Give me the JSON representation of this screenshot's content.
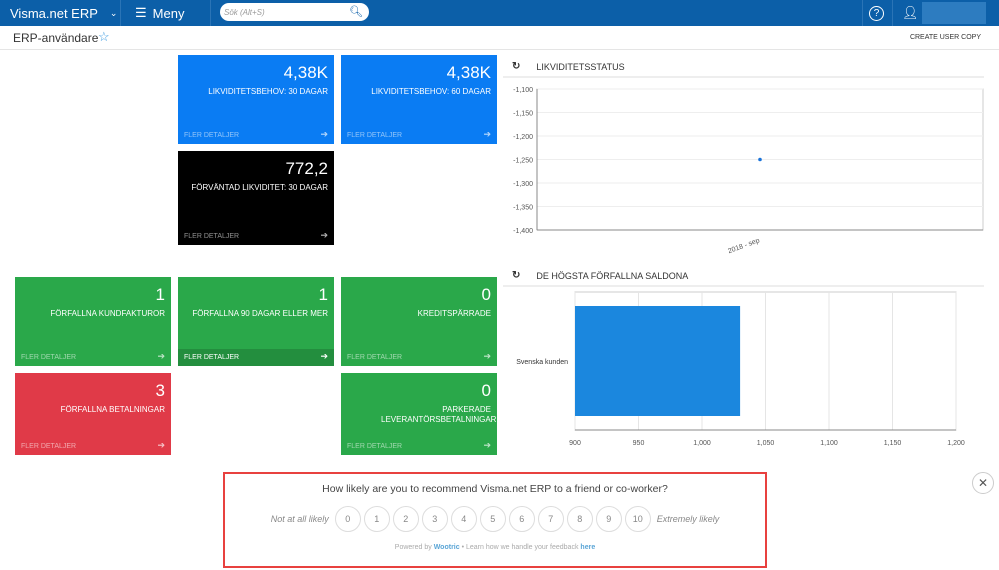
{
  "topbar": {
    "app": "Visma.net ERP",
    "menu": "Meny",
    "search_placeholder": "Sök (Alt+S)"
  },
  "page": {
    "title": "ERP-användare",
    "action": "CREATE USER COPY"
  },
  "tiles": [
    {
      "value": "4,38K",
      "label": "LIKVIDITETSBEHOV: 30 DAGAR",
      "more": "FLER DETALJER"
    },
    {
      "value": "4,38K",
      "label": "LIKVIDITETSBEHOV: 60 DAGAR",
      "more": "FLER DETALJER"
    },
    {
      "value": "772,2",
      "label": "FÖRVÄNTAD LIKVIDITET: 30 DAGAR",
      "more": "FLER DETALJER"
    },
    {
      "value": "1",
      "label": "FÖRFALLNA KUNDFAKTUROR",
      "more": "FLER DETALJER"
    },
    {
      "value": "1",
      "label": "FÖRFALLNA 90 DAGAR ELLER MER",
      "more": "FLER DETALJER"
    },
    {
      "value": "0",
      "label": "KREDITSPÄRRADE",
      "more": "FLER DETALJER"
    },
    {
      "value": "3",
      "label": "FÖRFALLNA BETALNINGAR",
      "more": "FLER DETALJER"
    },
    {
      "value": "0",
      "label": "PARKERADE LEVERANTÖRSBETALNINGAR",
      "more": "FLER DETALJER"
    }
  ],
  "chart_data": [
    {
      "type": "scatter",
      "title": "LIKVIDITETSSTATUS",
      "categories": [
        "2018 - sep"
      ],
      "values": [
        -1250
      ],
      "ylim": [
        -1400,
        -1100
      ],
      "yticks": [
        "-1,100",
        "-1,150",
        "-1,200",
        "-1,250",
        "-1,300",
        "-1,350",
        "-1,400"
      ]
    },
    {
      "type": "bar",
      "orientation": "horizontal",
      "title": "DE HÖGSTA FÖRFALLNA SALDONA",
      "categories": [
        "Svenska kunden"
      ],
      "values": [
        1030
      ],
      "xlim": [
        900,
        1200
      ],
      "xticks": [
        "900",
        "950",
        "1,000",
        "1,050",
        "1,100",
        "1,150",
        "1,200"
      ]
    }
  ],
  "survey": {
    "question": "How likely are you to recommend Visma.net ERP to a friend or co-worker?",
    "low": "Not at all likely",
    "high": "Extremely likely",
    "scores": [
      "0",
      "1",
      "2",
      "3",
      "4",
      "5",
      "6",
      "7",
      "8",
      "9",
      "10"
    ],
    "powered": "Powered by",
    "brand": "Wootric",
    "learn": "• Learn how we handle your feedback",
    "here": "here"
  }
}
